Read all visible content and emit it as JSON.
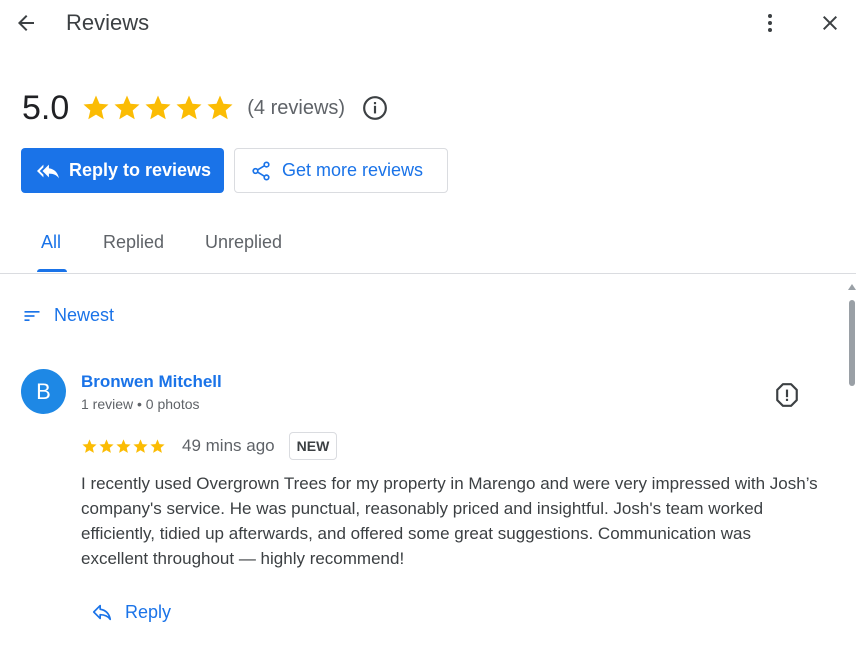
{
  "header": {
    "title": "Reviews",
    "back_icon": "arrow-back-icon",
    "more_icon": "more-vert-icon",
    "close_icon": "close-icon"
  },
  "summary": {
    "rating": "5.0",
    "stars": 5,
    "review_count": "(4 reviews)",
    "info_icon": "info-icon",
    "star_color": "#fbbc04"
  },
  "actions": {
    "reply_label": "Reply to reviews",
    "get_more_label": "Get more reviews"
  },
  "tabs": [
    {
      "label": "All",
      "active": true
    },
    {
      "label": "Replied",
      "active": false
    },
    {
      "label": "Unreplied",
      "active": false
    }
  ],
  "sort": {
    "label": "Newest",
    "icon": "sort-icon"
  },
  "reviews": [
    {
      "avatar_initial": "B",
      "name": "Bronwen Mitchell",
      "meta": "1 review • 0 photos",
      "stars": 5,
      "time": "49 mins ago",
      "badge": "NEW",
      "text": "I recently used Overgrown Trees for my property in Marengo and were very impressed with Josh’s company's service. He was punctual, reasonably priced and insightful. Josh's team worked efficiently, tidied up afterwards, and offered some great suggestions. Communication was excellent throughout — highly recommend!",
      "reply_label": "Reply",
      "flag_icon": "report-icon"
    }
  ],
  "colors": {
    "accent": "#1a73e8",
    "avatar": "#1e88e5",
    "text_secondary": "#5f6368",
    "divider": "#dadce0"
  }
}
